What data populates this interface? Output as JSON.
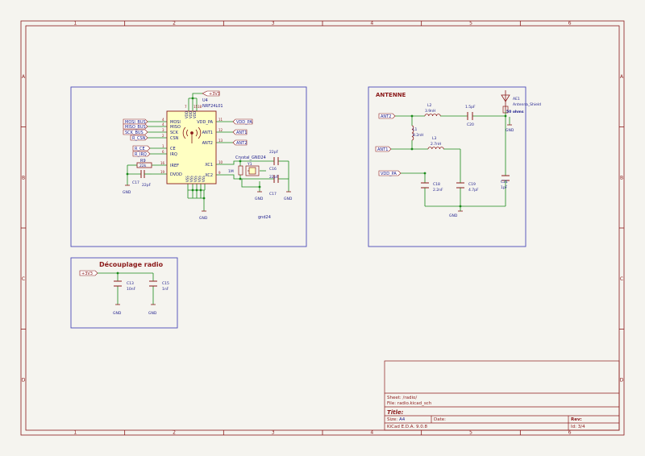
{
  "colors": {
    "page_bg": "#f5f4ef",
    "frame": "#8b1a1a",
    "wire": "#1a8a1a",
    "component": "#8b1a1a",
    "component_fill": "#ffffc2",
    "label": "#00557a",
    "box": "#4a4ab8",
    "title_text": "#8b1a1a",
    "pin_text": "#1c1c8c"
  },
  "frame": {
    "col_labels": [
      "1",
      "2",
      "3",
      "4",
      "5",
      "6"
    ],
    "row_labels": [
      "A",
      "B",
      "C",
      "D"
    ]
  },
  "sections": {
    "antenna_title": "ANTENNE",
    "decoupling_title": "Découplage radio"
  },
  "radio": {
    "supply": "+3V3",
    "ref": "U4",
    "value": "NRF24L01",
    "pins_left": [
      "MOSI",
      "MISO",
      "SCK",
      "CSN",
      "CE",
      "IRQ",
      "IREF",
      "DVDD"
    ],
    "pins_left_num": [
      "4",
      "4",
      "3",
      "2",
      "1",
      "6",
      "16",
      "19"
    ],
    "pins_right": [
      "VDD_PA",
      "ANT1",
      "ANT2",
      "XC1",
      "XC2"
    ],
    "pins_right_num": [
      "11",
      "12",
      "13",
      "10",
      "9"
    ],
    "pins_bottom": [
      "VSS",
      "VSS",
      "VSS",
      "VSS",
      "VSS"
    ],
    "top_pins": [
      "VDD",
      "VDD",
      "VDD"
    ],
    "top_pin_nums": [
      "7",
      "15",
      "18"
    ],
    "labels_left": [
      "MOSI_BUS",
      "MISO_BUS",
      "SCK_BUS",
      "R_CSN",
      "R_CE",
      "R_IRQ"
    ],
    "labels_right": [
      "VDD_PA",
      "ANT1",
      "ANT2"
    ],
    "r9": {
      "ref": "R9",
      "value": "22k"
    },
    "c17_left": {
      "ref": "C17",
      "value": "22pF"
    },
    "crystal_ref": "Y1",
    "crystal_label": "Crystal_GND24",
    "crystal_res": "1M",
    "c16": {
      "ref": "C16",
      "value": "22pF"
    },
    "c17": {
      "ref": "C17",
      "value": "22pF"
    },
    "gnd_label": "gnd24",
    "gnd": "GND"
  },
  "antenna": {
    "labels": [
      "ANT2",
      "ANT1",
      "VDD_PA"
    ],
    "l2": {
      "ref": "L2",
      "value": "3.9nH"
    },
    "c20": {
      "ref": "C20",
      "value": "1.5pF"
    },
    "l1": {
      "ref": "L1",
      "value": "8.2nH"
    },
    "l3": {
      "ref": "L3",
      "value": "2.7nH"
    },
    "c18": {
      "ref": "C18",
      "value": "2.2nF"
    },
    "c19": {
      "ref": "C19",
      "value": "4.7pF"
    },
    "c21": {
      "ref": "C21",
      "value": "1pF"
    },
    "ae1": {
      "ref": "AE1",
      "value": "Antenna_Shield",
      "note": "50 ohms"
    },
    "gnd": "GND"
  },
  "decoupling": {
    "supply": "+3V3",
    "c13": {
      "ref": "C13",
      "value": "10nF"
    },
    "c15": {
      "ref": "C15",
      "value": "1nF"
    },
    "gnd": "GND"
  },
  "title_block": {
    "sheet": "Sheet: /radio/",
    "file": "File: radio.kicad_sch",
    "title_label": "Title:",
    "size_label": "Size:",
    "size_value": "A4",
    "date_label": "Date:",
    "rev_label": "Rev:",
    "tool": "KiCad E.D.A. 9.0.8",
    "id": "Id: 3/4"
  }
}
